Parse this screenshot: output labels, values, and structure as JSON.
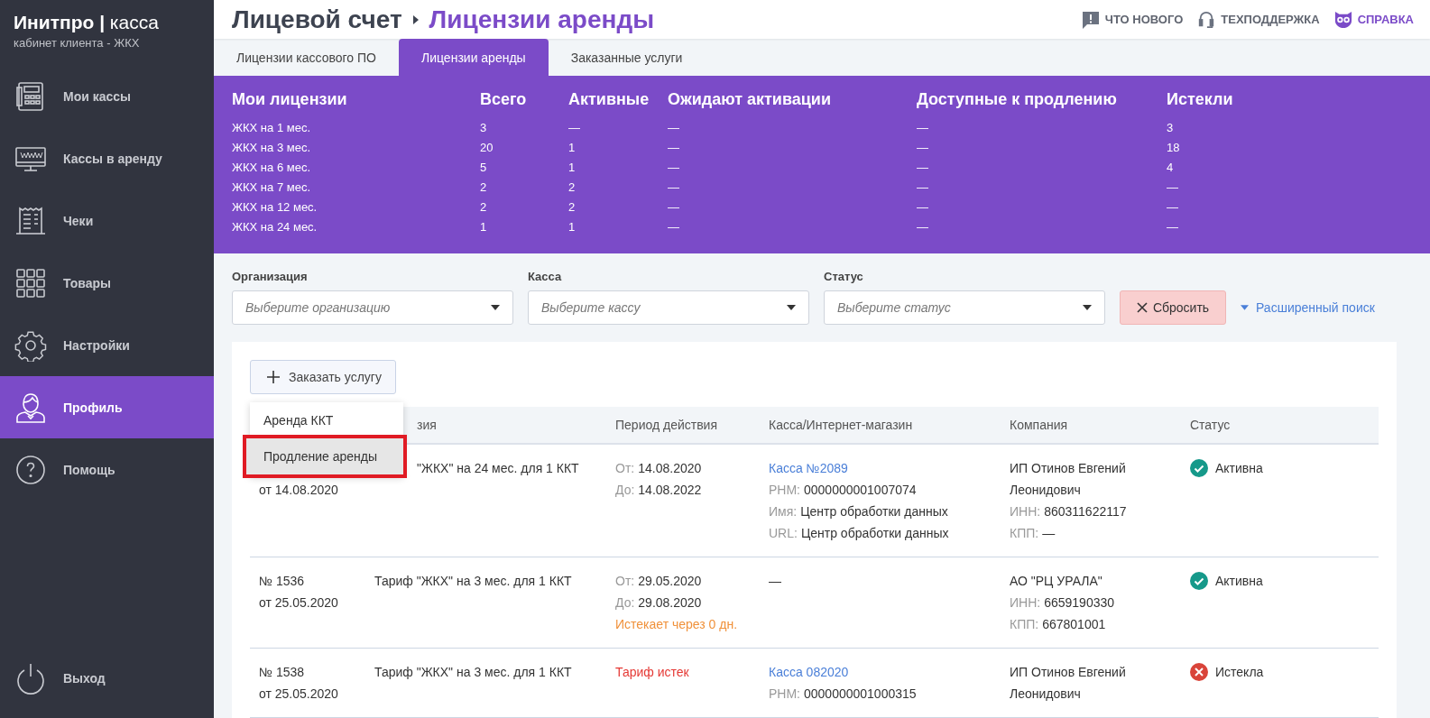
{
  "brand": {
    "name": "Инитпро",
    "separator": "|",
    "product": "касса",
    "subtitle": "кабинет клиента - ЖКХ"
  },
  "sidebar": {
    "items": [
      {
        "kind": "register",
        "label": "Мои кассы",
        "selected": false
      },
      {
        "kind": "monitor",
        "label": "Кассы в аренду",
        "selected": false
      },
      {
        "kind": "receipt",
        "label": "Чеки",
        "selected": false
      },
      {
        "kind": "grid",
        "label": "Товары",
        "selected": false
      },
      {
        "kind": "gear",
        "label": "Настройки",
        "selected": false
      },
      {
        "kind": "person",
        "label": "Профиль",
        "selected": true
      },
      {
        "kind": "help",
        "label": "Помощь",
        "selected": false
      }
    ],
    "logout": "Выход"
  },
  "breadcrumb": {
    "parent": "Лицевой счет",
    "current": "Лицензии аренды"
  },
  "header_links": [
    {
      "kind": "news",
      "label": "ЧТО НОВОГО"
    },
    {
      "kind": "support",
      "label": "ТЕХПОДДЕРЖКА"
    },
    {
      "kind": "help",
      "label": "СПРАВКА"
    }
  ],
  "tabs": [
    {
      "label": "Лицензии кассового ПО",
      "selected": false
    },
    {
      "label": "Лицензии аренды",
      "selected": true
    },
    {
      "label": "Заказанные услуги",
      "selected": false
    }
  ],
  "summary": {
    "columns": [
      "Мои лицензии",
      "Всего",
      "Активные",
      "Ожидают активации",
      "Доступные к продлению",
      "Истекли"
    ],
    "rows": [
      [
        "ЖКХ на 1 мес.",
        "3",
        "—",
        "—",
        "—",
        "3"
      ],
      [
        "ЖКХ на 3 мес.",
        "20",
        "1",
        "—",
        "—",
        "18"
      ],
      [
        "ЖКХ на 6 мес.",
        "5",
        "1",
        "—",
        "—",
        "4"
      ],
      [
        "ЖКХ на 7 мес.",
        "2",
        "2",
        "—",
        "—",
        "—"
      ],
      [
        "ЖКХ на 12 мес.",
        "2",
        "2",
        "—",
        "—",
        "—"
      ],
      [
        "ЖКХ на 24 мес.",
        "1",
        "1",
        "—",
        "—",
        "—"
      ]
    ]
  },
  "filters": [
    {
      "label": "Организация",
      "placeholder": "Выберите организацию"
    },
    {
      "label": "Касса",
      "placeholder": "Выберите кассу"
    },
    {
      "label": "Статус",
      "placeholder": "Выберите статус"
    }
  ],
  "reset_button": "Сбросить",
  "advanced_search": "Расширенный поиск",
  "order_button": "Заказать услугу",
  "order_menu": [
    {
      "label": "Аренда ККТ",
      "highlighted": false
    },
    {
      "label": "Продление аренды",
      "highlighted": true
    }
  ],
  "table": {
    "columns": [
      "",
      "зия",
      "Период действия",
      "Касса/Интернет-магазин",
      "Компания",
      "Статус"
    ],
    "rows": [
      {
        "date": "от 14.08.2020",
        "tariff": "\"ЖКХ\" на 24 мес. для 1 ККТ",
        "period": [
          {
            "kind": "pair",
            "label": "От:",
            "value": "14.08.2020"
          },
          {
            "kind": "pair",
            "label": "До:",
            "value": "14.08.2022"
          }
        ],
        "kassa": {
          "link": "Касса №2089",
          "lines": [
            {
              "label": "РНМ:",
              "value": "0000000001007074"
            },
            {
              "label": "Имя:",
              "value": "Центр обработки данных"
            },
            {
              "label": "URL:",
              "value": "Центр обработки данных"
            }
          ]
        },
        "company": [
          {
            "value": "ИП Отинов Евгений"
          },
          {
            "value": "Леонидович"
          },
          {
            "label": "ИНН:",
            "value": "860311622117"
          },
          {
            "label": "КПП:",
            "value": "—"
          }
        ],
        "status": {
          "kind": "active",
          "label": "Активна"
        }
      },
      {
        "number": "№ 1536",
        "date": "от 25.05.2020",
        "tariff": "Тариф \"ЖКХ\" на 3 мес. для 1 ККТ",
        "period": [
          {
            "kind": "pair",
            "label": "От:",
            "value": "29.05.2020"
          },
          {
            "kind": "pair",
            "label": "До:",
            "value": "29.08.2020"
          },
          {
            "kind": "warning",
            "value": "Истекает через 0 дн."
          }
        ],
        "kassa": {
          "empty": "—"
        },
        "company": [
          {
            "value": "АО \"РЦ УРАЛА\""
          },
          {
            "label": "ИНН:",
            "value": "6659190330"
          },
          {
            "label": "КПП:",
            "value": "667801001"
          }
        ],
        "status": {
          "kind": "active",
          "label": "Активна"
        }
      },
      {
        "number": "№ 1538",
        "date": "от 25.05.2020",
        "tariff": "Тариф \"ЖКХ\" на 3 мес. для 1 ККТ",
        "period": [
          {
            "kind": "error",
            "value": "Тариф истек"
          }
        ],
        "kassa": {
          "link": "Касса 082020",
          "lines": [
            {
              "label": "РНМ:",
              "value": "0000000001000315"
            }
          ]
        },
        "company": [
          {
            "value": "ИП Отинов Евгений"
          },
          {
            "value": "Леонидович"
          }
        ],
        "status": {
          "kind": "expired",
          "label": "Истекла"
        }
      }
    ]
  }
}
